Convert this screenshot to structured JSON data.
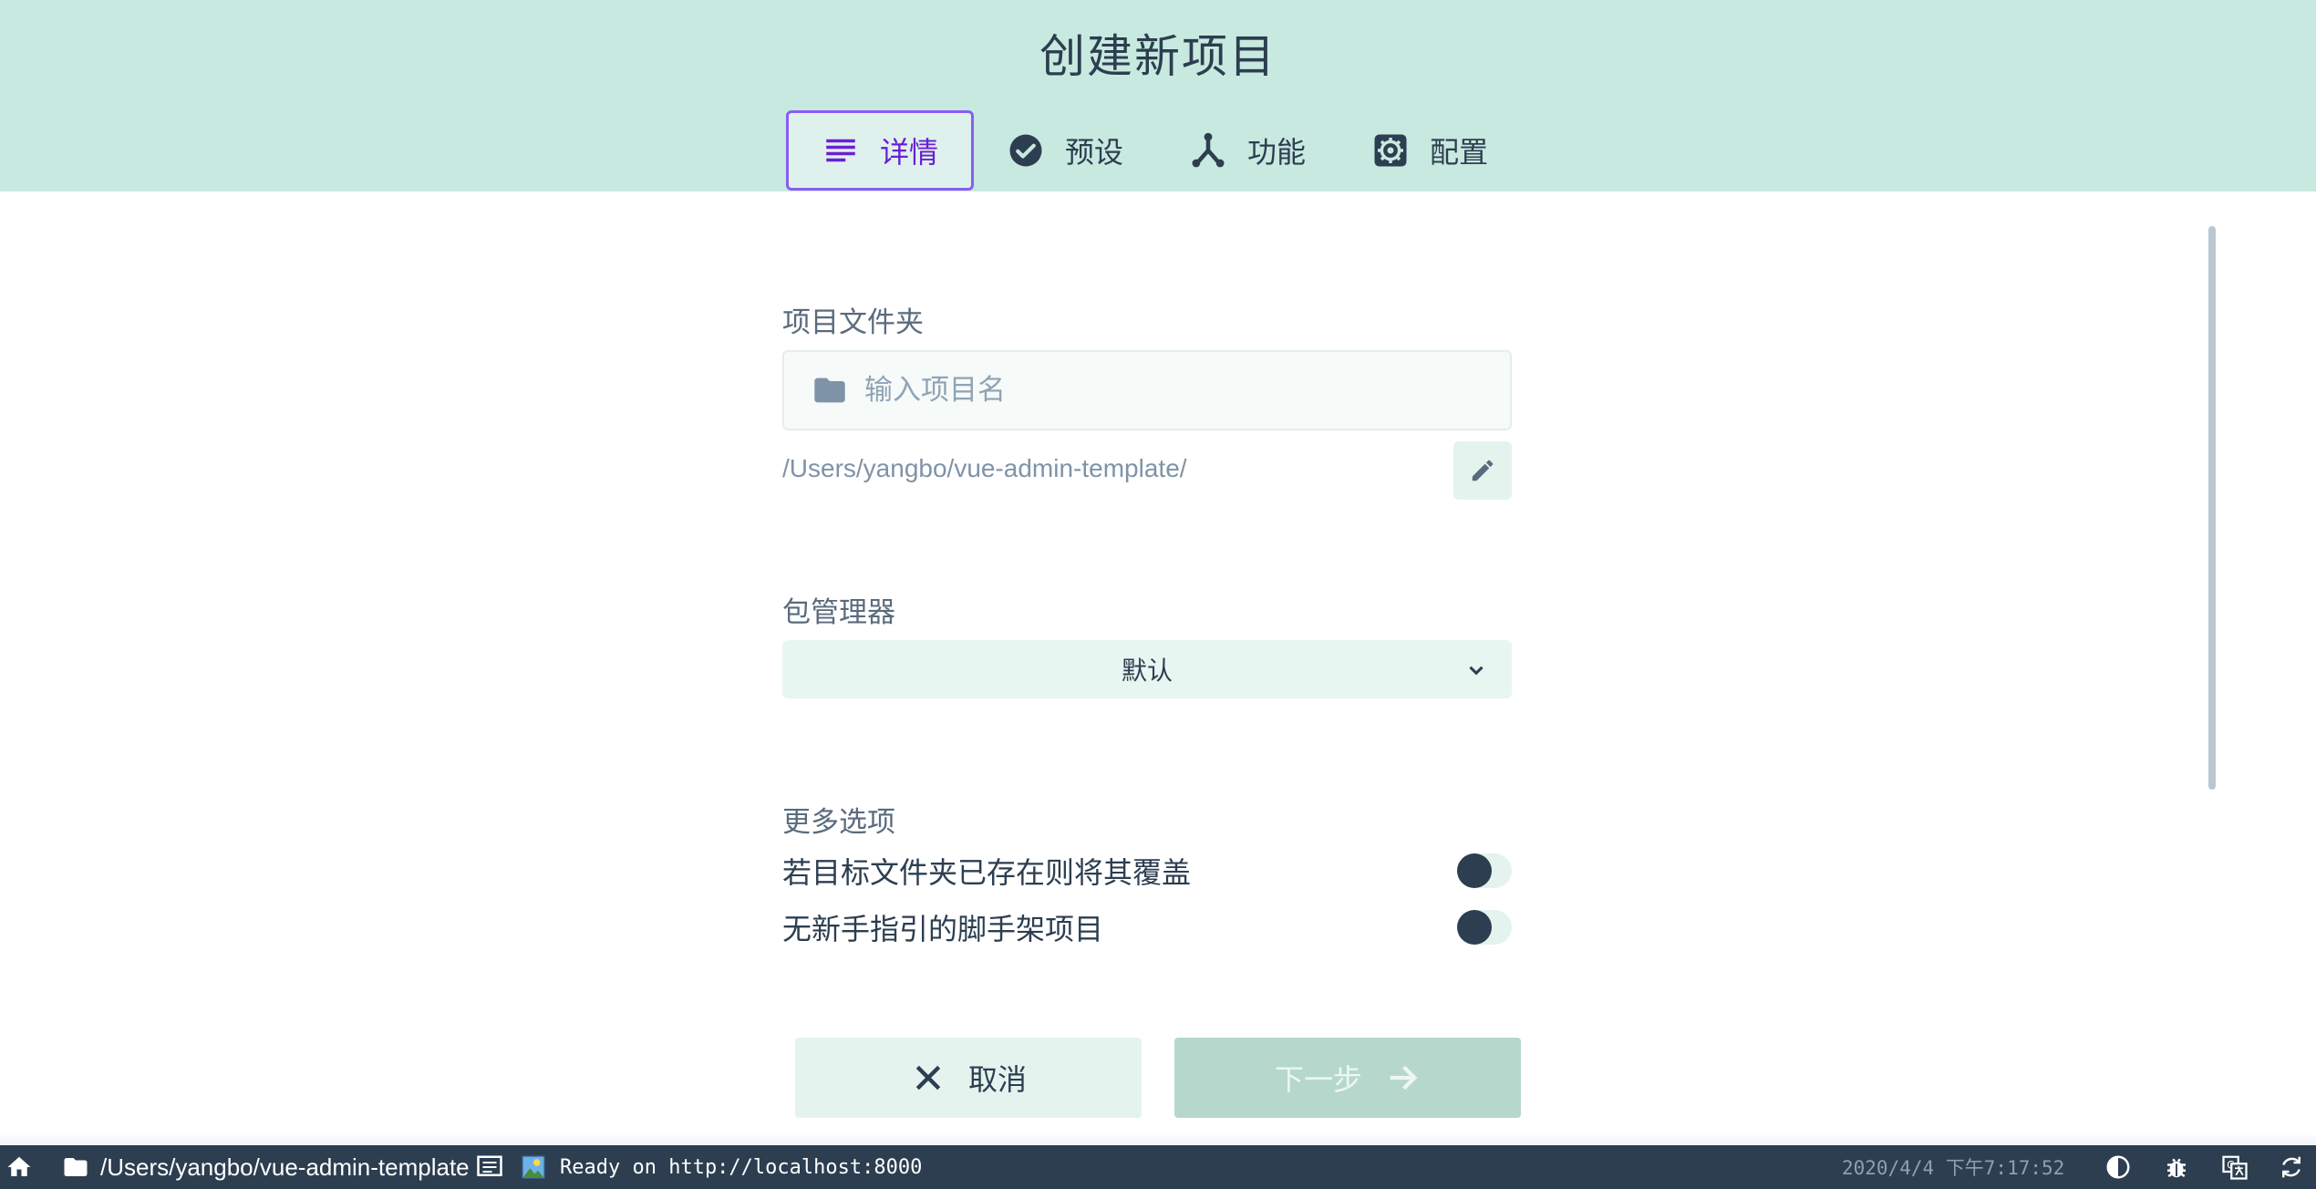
{
  "header": {
    "title": "创建新项目",
    "tabs": [
      {
        "label": "详情",
        "icon": "details-icon",
        "active": true
      },
      {
        "label": "预设",
        "icon": "check-circle-icon",
        "active": false
      },
      {
        "label": "功能",
        "icon": "fork-icon",
        "active": false
      },
      {
        "label": "配置",
        "icon": "gear-icon",
        "active": false
      }
    ]
  },
  "form": {
    "folder_section": {
      "label": "项目文件夹",
      "input_placeholder": "输入项目名",
      "input_value": "",
      "path": "/Users/yangbo/vue-admin-template/"
    },
    "package_manager": {
      "label": "包管理器",
      "selected": "默认"
    },
    "more_options": {
      "label": "更多选项",
      "options": [
        {
          "label": "若目标文件夹已存在则将其覆盖",
          "enabled": false
        },
        {
          "label": "无新手指引的脚手架项目",
          "enabled": false
        }
      ]
    }
  },
  "actions": {
    "cancel_label": "取消",
    "next_label": "下一步"
  },
  "statusbar": {
    "path": "/Users/yangbo/vue-admin-template",
    "ready_text": "Ready on http://localhost:8000",
    "time": "2020/4/4 下午7:17:52"
  },
  "colors": {
    "header_bg": "#c8e9df",
    "accent": "#6a1fd6",
    "text": "#2c3e50",
    "statusbar_bg": "#2c3e50"
  }
}
